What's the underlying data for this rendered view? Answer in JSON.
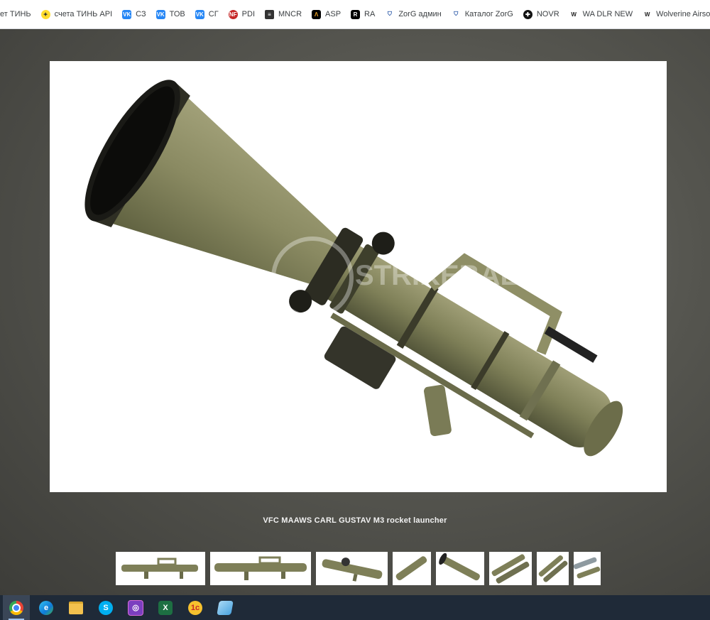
{
  "bookmarks": [
    {
      "label": "ет ТИНЬ",
      "icon": "none"
    },
    {
      "label": "счета ТИНЬ API",
      "icon": "tinkoff-icon"
    },
    {
      "label": "СЗ",
      "icon": "vk-icon"
    },
    {
      "label": "ТОВ",
      "icon": "vk-icon"
    },
    {
      "label": "СГ",
      "icon": "vk-icon"
    },
    {
      "label": "PDI",
      "icon": "nf-icon"
    },
    {
      "label": "MNCR",
      "icon": "mncr-icon"
    },
    {
      "label": "ASP",
      "icon": "asp-icon"
    },
    {
      "label": "RA",
      "icon": "ra-icon"
    },
    {
      "label": "ZorG админ",
      "icon": "zorg-icon"
    },
    {
      "label": "Каталог ZorG",
      "icon": "zorg-icon"
    },
    {
      "label": "NOVR",
      "icon": "novr-icon"
    },
    {
      "label": "WA DLR NEW",
      "icon": "wolverine-icon"
    },
    {
      "label": "Wolverine Airsoft",
      "icon": "wolverine-icon"
    }
  ],
  "viewer": {
    "caption": "VFC MAAWS CARL GUSTAV M3 rocket launcher",
    "watermark": "STRIKEBALL SOFT",
    "thumbnails_count": 8,
    "active_thumbnail": 5
  },
  "taskbar": [
    {
      "name": "chrome-icon",
      "color": "#fbbc04"
    },
    {
      "name": "edge-icon",
      "color": "#0f7ad8"
    },
    {
      "name": "file-explorer-icon",
      "color": "#f2c14e"
    },
    {
      "name": "skype-icon",
      "color": "#00aff0"
    },
    {
      "name": "app-icon",
      "color": "#7b3fbf"
    },
    {
      "name": "excel-icon",
      "color": "#1d6f42"
    },
    {
      "name": "1c-icon",
      "color": "#f6c12e"
    },
    {
      "name": "notes-icon",
      "color": "#4aa3df"
    }
  ],
  "colors": {
    "launcher_olive": "#8a8a62",
    "launcher_dark": "#5d5f3e"
  }
}
